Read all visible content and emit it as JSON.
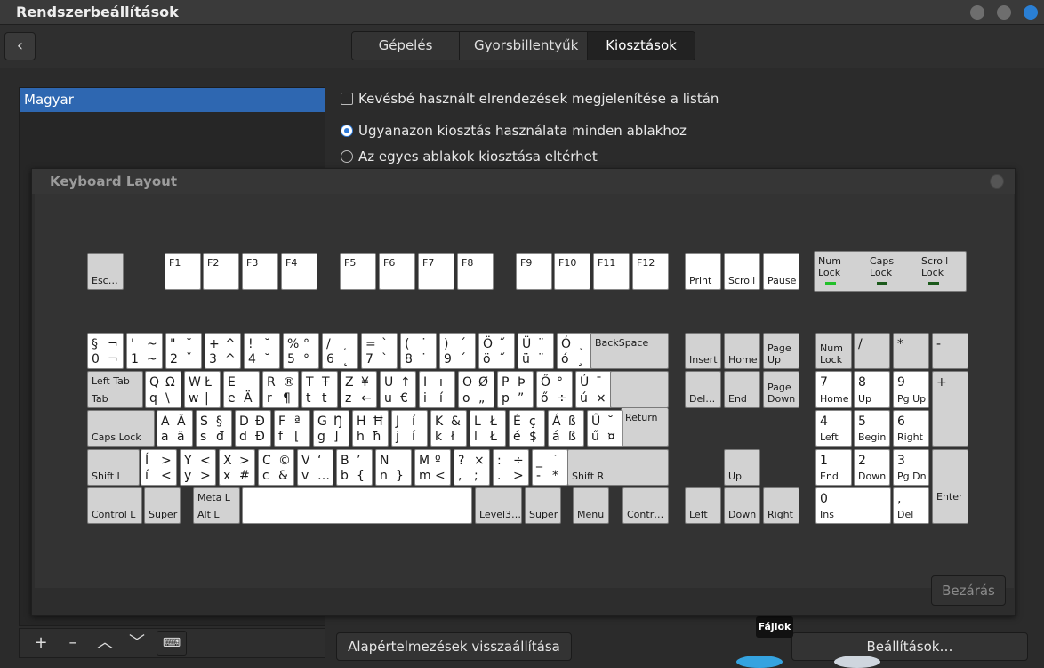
{
  "window": {
    "title": "Rendszerbeállítások"
  },
  "tabs": [
    "Gépelés",
    "Gyorsbillentyűk",
    "Kiosztások"
  ],
  "layouts_list": [
    "Magyar"
  ],
  "options": {
    "show_less": "Kevésbé használt elrendezések megjelenítése a listán",
    "same_layout": "Ugyanazon kiosztás használata minden ablakhoz",
    "per_window": "Az egyes ablakok kiosztása eltérhet"
  },
  "list_tools": [
    "+",
    "–",
    "︿",
    "﹀",
    "⌨"
  ],
  "buttons": {
    "reset": "Alapértelmezések visszaállítása",
    "settings": "Beállítások…"
  },
  "tooltip": "Fájlok",
  "dialog": {
    "title": "Keyboard Layout",
    "close": "Bezárás"
  },
  "keyboard": {
    "fn": {
      "esc": "Esc…",
      "f1": "F1",
      "f2": "F2",
      "f3": "F3",
      "f4": "F4",
      "f5": "F5",
      "f6": "F6",
      "f7": "F7",
      "f8": "F8",
      "f9": "F9",
      "f10": "F10",
      "f11": "F11",
      "f12": "F12",
      "print": "Print",
      "scroll": "Scroll Lock",
      "pause": "Pause"
    },
    "leds": {
      "num": "Num Lock",
      "caps": "Caps Lock",
      "scroll": "Scroll Lock"
    },
    "row1": [
      [
        "§",
        "¬",
        "0",
        "¬"
      ],
      [
        "'",
        "~",
        "1",
        "~"
      ],
      [
        "\"",
        "˘",
        "2",
        "ˇ"
      ],
      [
        "+",
        "^",
        "3",
        "^"
      ],
      [
        "!",
        "˘",
        "4",
        "˘"
      ],
      [
        "%",
        "°",
        "5",
        "°"
      ],
      [
        "/",
        "˛",
        "6",
        "˛"
      ],
      [
        "=",
        "`",
        "7",
        "`"
      ],
      [
        "(",
        "˙",
        "8",
        "˙"
      ],
      [
        ")",
        "´",
        "9",
        "´"
      ],
      [
        "Ö",
        "˝",
        "ö",
        "˝"
      ],
      [
        "Ü",
        "¨",
        "ü",
        "¨"
      ],
      [
        "Ó",
        "¸",
        "ó",
        "¸"
      ]
    ],
    "row2": [
      [
        "Q",
        "Ω",
        "q",
        "\\"
      ],
      [
        "W",
        "Ł",
        "w",
        "|"
      ],
      [
        "E",
        "",
        "e",
        "Ä"
      ],
      [
        "R",
        "®",
        "r",
        "¶"
      ],
      [
        "T",
        "Ŧ",
        "t",
        "ŧ"
      ],
      [
        "Z",
        "¥",
        "z",
        "←"
      ],
      [
        "U",
        "↑",
        "u",
        "€"
      ],
      [
        "I",
        "ı",
        "i",
        "í"
      ],
      [
        "O",
        "Ø",
        "o",
        "„"
      ],
      [
        "P",
        "Þ",
        "p",
        "”"
      ],
      [
        "Ő",
        "°",
        "ő",
        "÷"
      ],
      [
        "Ú",
        "¯",
        "ú",
        "×"
      ]
    ],
    "row3": [
      [
        "A",
        "Ä",
        "a",
        "ä"
      ],
      [
        "S",
        "§",
        "s",
        "đ"
      ],
      [
        "D",
        "Đ",
        "d",
        "Đ"
      ],
      [
        "F",
        "ª",
        "f",
        "["
      ],
      [
        "G",
        "Ŋ",
        "g",
        "]"
      ],
      [
        "H",
        "Ħ",
        "h",
        "ħ"
      ],
      [
        "J",
        "í",
        "j",
        "í"
      ],
      [
        "K",
        "&",
        "k",
        "ł"
      ],
      [
        "L",
        "Ł",
        "l",
        "Ł"
      ],
      [
        "É",
        "ç",
        "é",
        "$"
      ],
      [
        "Á",
        "ß",
        "á",
        "ß"
      ],
      [
        "Ű",
        "˘",
        "ű",
        "¤"
      ]
    ],
    "row4": [
      [
        "Í",
        ">",
        "í",
        "<"
      ],
      [
        "Y",
        "<",
        "y",
        ">"
      ],
      [
        "X",
        ">",
        "x",
        "#"
      ],
      [
        "C",
        "©",
        "c",
        "&"
      ],
      [
        "V",
        "‘",
        "v",
        "…"
      ],
      [
        "B",
        "’",
        "b",
        "{"
      ],
      [
        "N",
        "",
        "n",
        "}"
      ],
      [
        "M",
        "º",
        "m",
        "<"
      ],
      [
        "?",
        "×",
        ",",
        ";"
      ],
      [
        ":",
        "÷",
        ".",
        ">"
      ],
      [
        "_",
        "˙",
        "-",
        "*"
      ]
    ],
    "special": {
      "backspace": "BackSpace",
      "lefttab": "Left Tab",
      "tab": "Tab",
      "caps": "Caps Lock",
      "ret": "Return",
      "shiftl": "Shift L",
      "shiftr": "Shift R",
      "ctrll": "Control L",
      "superl": "Super L",
      "metal": "Meta L",
      "altl": "Alt L",
      "level3": "Level3…",
      "superr": "Super R",
      "menu": "Menu",
      "ctrlr": "Contr…"
    },
    "nav": {
      "insert": "Insert",
      "home": "Home",
      "pageup": "Page Up",
      "delete": "Del…",
      "end": "End",
      "pagedown": "Page Down",
      "up": "Up",
      "left": "Left",
      "down": "Down",
      "right": "Right"
    },
    "numpad": {
      "numlock": "Num Lock",
      "slash": "/",
      "star": "*",
      "minus": "-",
      "plus": "+",
      "enter": "Enter",
      "n7": [
        "7",
        "Home"
      ],
      "n8": [
        "8",
        "Up"
      ],
      "n9": [
        "9",
        "Pg Up"
      ],
      "n4": [
        "4",
        "Left"
      ],
      "n5": [
        "5",
        "Begin"
      ],
      "n6": [
        "6",
        "Right"
      ],
      "n1": [
        "1",
        "End"
      ],
      "n2": [
        "2",
        "Down"
      ],
      "n3": [
        "3",
        "Pg Dn"
      ],
      "n0": [
        "0",
        "Ins"
      ],
      "dot": [
        ",",
        "Del"
      ]
    }
  }
}
